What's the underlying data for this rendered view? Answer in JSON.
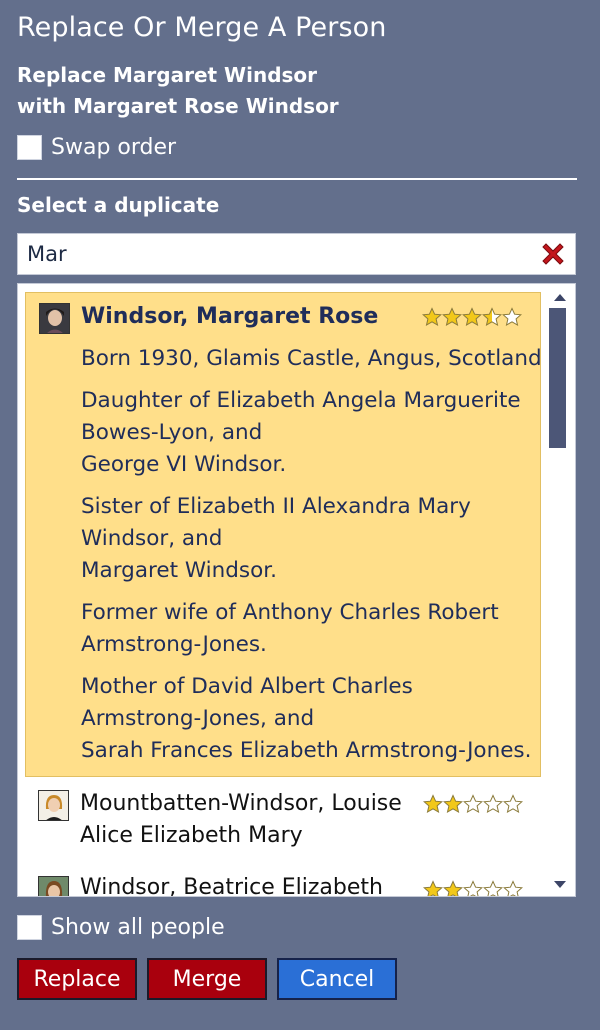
{
  "dialog": {
    "title": "Replace Or Merge A Person",
    "subtitle_line1": "Replace Margaret Windsor",
    "subtitle_line2": "with Margaret Rose Windsor",
    "swap_label": "Swap order",
    "swap_checked": false,
    "section_label": "Select a duplicate"
  },
  "search": {
    "value": "Mar",
    "clear_icon": "clear-x-icon",
    "clear_color": "#c4161c"
  },
  "list": {
    "items": [
      {
        "name": "Windsor, Margaret Rose",
        "rating": 3.5,
        "selected": true,
        "details": [
          "Born 1930, Glamis Castle, Angus, Scotland",
          "Daughter of Elizabeth Angela Marguerite",
          "Bowes-Lyon, and",
          "George VI Windsor.",
          "Sister of Elizabeth II Alexandra Mary",
          "Windsor, and",
          "Margaret Windsor.",
          "Former wife of Anthony Charles Robert",
          "Armstrong-Jones.",
          "Mother of David Albert Charles",
          "Armstrong-Jones, and",
          "Sarah Frances Elizabeth Armstrong-Jones."
        ]
      },
      {
        "name_line1": "Mountbatten-Windsor, Louise",
        "name_line2": "Alice Elizabeth Mary",
        "rating": 2,
        "selected": false
      },
      {
        "name": "Windsor, Beatrice Elizabeth",
        "rating": 2,
        "selected": false
      }
    ],
    "max_rating": 5,
    "selected_bg": "#ffdf8a"
  },
  "footer": {
    "show_all_label": "Show all people",
    "show_all_checked": false,
    "replace_label": "Replace",
    "merge_label": "Merge",
    "cancel_label": "Cancel"
  },
  "colors": {
    "background": "#636f8c",
    "danger_button": "#a9000d",
    "primary_button": "#2a6fd6",
    "star_fill": "#f2c81a"
  }
}
